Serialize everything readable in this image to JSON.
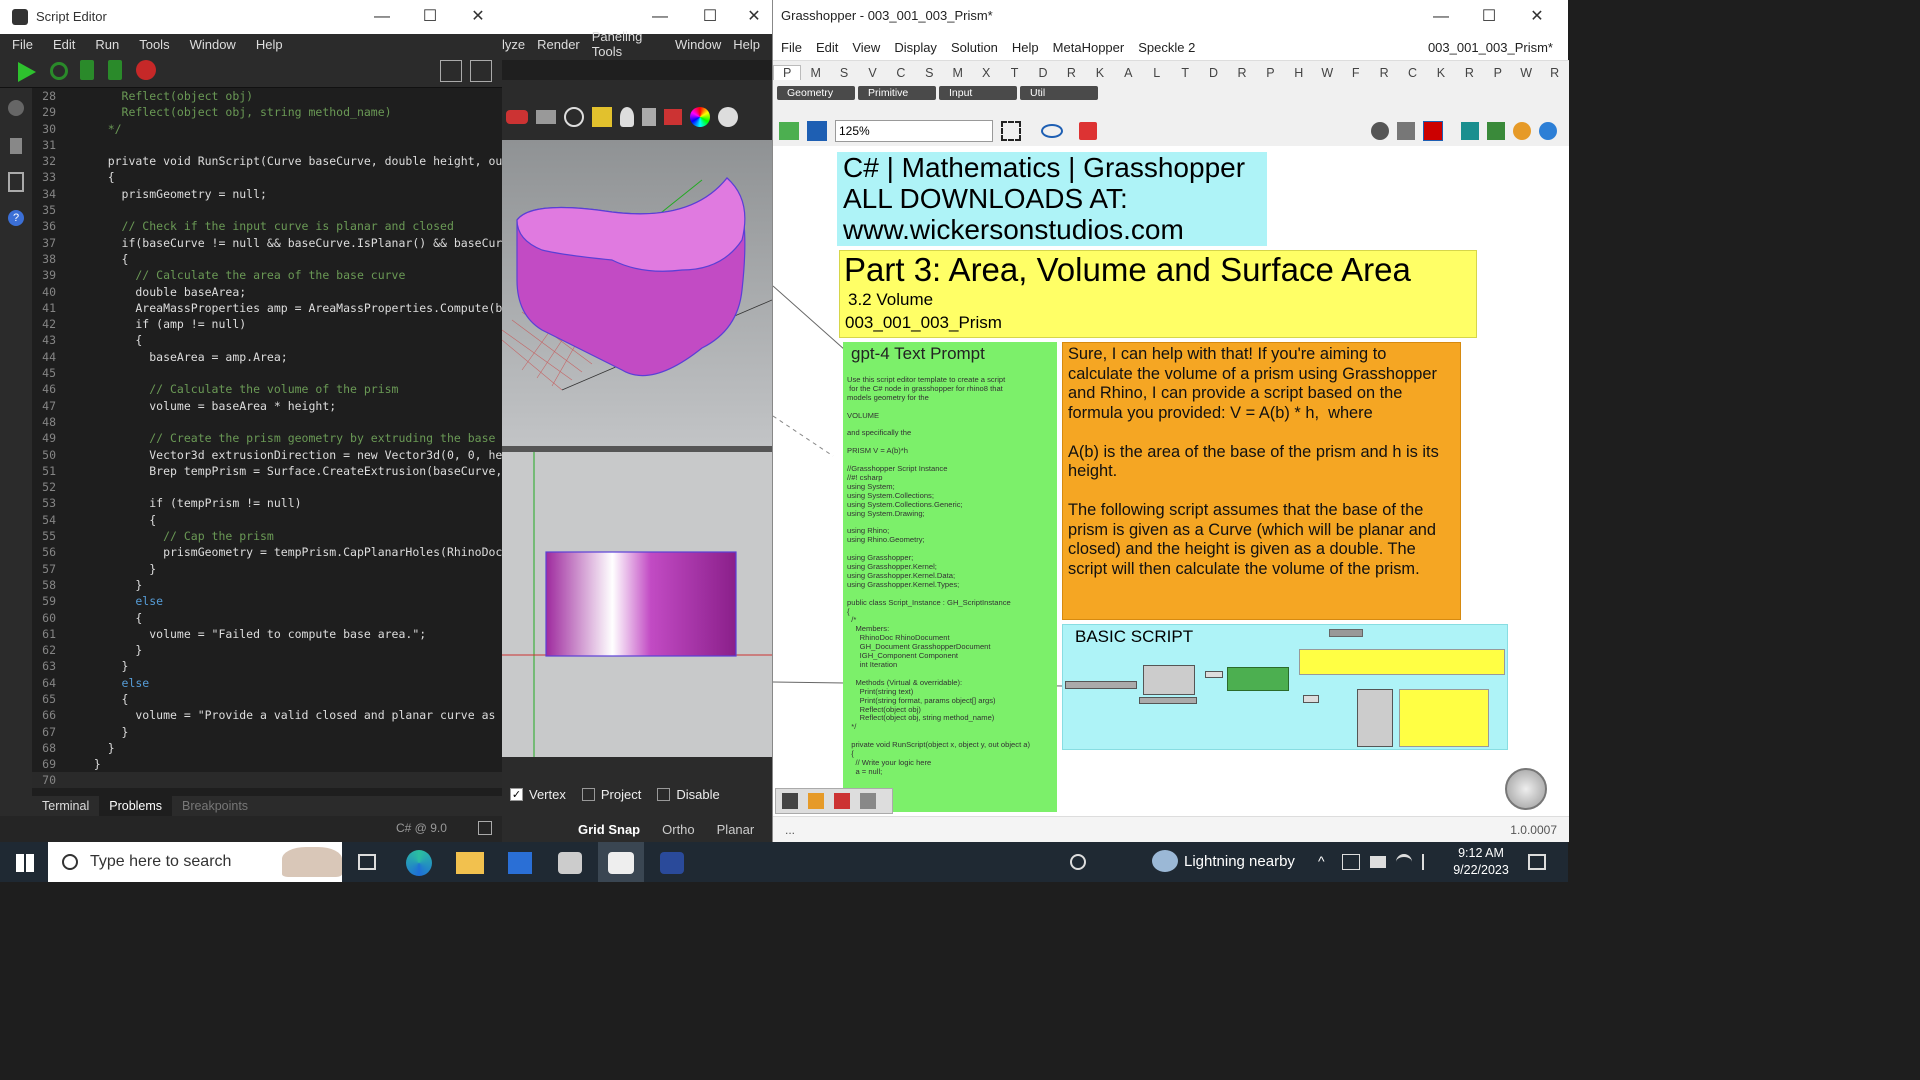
{
  "script_editor": {
    "title": "Script Editor",
    "menu": [
      "File",
      "Edit",
      "Run",
      "Tools",
      "Window",
      "Help"
    ],
    "code_lines": [
      {
        "n": "28",
        "t": "      Reflect(object obj)",
        "c": "cm"
      },
      {
        "n": "29",
        "t": "      Reflect(object obj, string method_name)",
        "c": "cm"
      },
      {
        "n": "30",
        "t": "    */",
        "c": "cm"
      },
      {
        "n": "31",
        "t": "",
        "c": ""
      },
      {
        "n": "32",
        "t": "    private void RunScript(Curve baseCurve, double height, ou",
        "c": ""
      },
      {
        "n": "33",
        "t": "    {",
        "c": ""
      },
      {
        "n": "34",
        "t": "      prismGeometry = null;",
        "c": ""
      },
      {
        "n": "35",
        "t": "",
        "c": ""
      },
      {
        "n": "36",
        "t": "      // Check if the input curve is planar and closed",
        "c": "cm"
      },
      {
        "n": "37",
        "t": "      if(baseCurve != null && baseCurve.IsPlanar() && baseCur",
        "c": ""
      },
      {
        "n": "38",
        "t": "      {",
        "c": ""
      },
      {
        "n": "39",
        "t": "        // Calculate the area of the base curve",
        "c": "cm"
      },
      {
        "n": "40",
        "t": "        double baseArea;",
        "c": ""
      },
      {
        "n": "41",
        "t": "        AreaMassProperties amp = AreaMassProperties.Compute(b",
        "c": ""
      },
      {
        "n": "42",
        "t": "        if (amp != null)",
        "c": ""
      },
      {
        "n": "43",
        "t": "        {",
        "c": ""
      },
      {
        "n": "44",
        "t": "          baseArea = amp.Area;",
        "c": ""
      },
      {
        "n": "45",
        "t": "",
        "c": ""
      },
      {
        "n": "46",
        "t": "          // Calculate the volume of the prism",
        "c": "cm"
      },
      {
        "n": "47",
        "t": "          volume = baseArea * height;",
        "c": ""
      },
      {
        "n": "48",
        "t": "",
        "c": ""
      },
      {
        "n": "49",
        "t": "          // Create the prism geometry by extruding the base",
        "c": "cm"
      },
      {
        "n": "50",
        "t": "          Vector3d extrusionDirection = new Vector3d(0, 0, he",
        "c": ""
      },
      {
        "n": "51",
        "t": "          Brep tempPrism = Surface.CreateExtrusion(baseCurve,",
        "c": ""
      },
      {
        "n": "52",
        "t": "",
        "c": ""
      },
      {
        "n": "53",
        "t": "          if (tempPrism != null)",
        "c": ""
      },
      {
        "n": "54",
        "t": "          {",
        "c": ""
      },
      {
        "n": "55",
        "t": "            // Cap the prism",
        "c": "cm"
      },
      {
        "n": "56",
        "t": "            prismGeometry = tempPrism.CapPlanarHoles(RhinoDoc",
        "c": ""
      },
      {
        "n": "57",
        "t": "          }",
        "c": ""
      },
      {
        "n": "58",
        "t": "        }",
        "c": ""
      },
      {
        "n": "59",
        "t": "        else",
        "c": "kw"
      },
      {
        "n": "60",
        "t": "        {",
        "c": ""
      },
      {
        "n": "61",
        "t": "          volume = \"Failed to compute base area.\";",
        "c": ""
      },
      {
        "n": "62",
        "t": "        }",
        "c": ""
      },
      {
        "n": "63",
        "t": "      }",
        "c": ""
      },
      {
        "n": "64",
        "t": "      else",
        "c": "kw"
      },
      {
        "n": "65",
        "t": "      {",
        "c": ""
      },
      {
        "n": "66",
        "t": "        volume = \"Provide a valid closed and planar curve as",
        "c": ""
      },
      {
        "n": "67",
        "t": "      }",
        "c": ""
      },
      {
        "n": "68",
        "t": "    }",
        "c": ""
      },
      {
        "n": "69",
        "t": "  }",
        "c": ""
      },
      {
        "n": "70",
        "t": "",
        "c": ""
      }
    ],
    "bottom_tabs": [
      "Terminal",
      "Problems",
      "Breakpoints"
    ],
    "status": "C# @ 9.0"
  },
  "rhino": {
    "menu": [
      "lyze",
      "Render",
      "Paneling Tools",
      "Window",
      "Help"
    ],
    "snaps": [
      "Vertex",
      "Project",
      "Disable"
    ],
    "status": [
      "Grid Snap",
      "Ortho",
      "Planar"
    ]
  },
  "grasshopper": {
    "title": "Grasshopper - 003_001_003_Prism*",
    "menu": [
      "File",
      "Edit",
      "View",
      "Display",
      "Solution",
      "Help",
      "MetaHopper",
      "Speckle 2"
    ],
    "doc_name": "003_001_003_Prism*",
    "tabs": [
      "P",
      "M",
      "S",
      "V",
      "C",
      "S",
      "M",
      "X",
      "T",
      "D",
      "R",
      "K",
      "A",
      "L",
      "T",
      "D",
      "R",
      "P",
      "H",
      "W",
      "F",
      "R",
      "C",
      "K",
      "R",
      "P",
      "W",
      "R"
    ],
    "categories": [
      "Geometry",
      "Primitive",
      "Input",
      "Util"
    ],
    "zoom": "125%",
    "header": [
      "C# | Mathematics | Grasshopper",
      "ALL DOWNLOADS AT:",
      "www.wickersonstudios.com"
    ],
    "part_title": "Part 3: Area, Volume and Surface Area",
    "section": "3.2 Volume",
    "file_label": "003_001_003_Prism",
    "prompt_title": "gpt-4 Text Prompt",
    "prompt_text": "Use this script editor template to create a script\n for the C# node in grasshopper for rhino8 that\nmodels geometry for the\n\nVOLUME\n\nand specifically the\n\nPRISM V = A(b)*h\n\n//Grasshopper Script Instance\n//#! csharp\nusing System;\nusing System.Collections;\nusing System.Collections.Generic;\nusing System.Drawing;\n\nusing Rhino;\nusing Rhino.Geometry;\n\nusing Grasshopper;\nusing Grasshopper.Kernel;\nusing Grasshopper.Kernel.Data;\nusing Grasshopper.Kernel.Types;\n\npublic class Script_Instance : GH_ScriptInstance\n{\n  /*\n    Members:\n      RhinoDoc RhinoDocument\n      GH_Document GrasshopperDocument\n      IGH_Component Component\n      int Iteration\n\n    Methods (Virtual & overridable):\n      Print(string text)\n      Print(string format, params object[] args)\n      Reflect(object obj)\n      Reflect(object obj, string method_name)\n  */\n\n  private void RunScript(object x, object y, out object a)\n  {\n    // Write your logic here\n    a = null;",
    "answer_text": "Sure, I can help with that! If you're aiming to calculate the volume of a prism using Grasshopper and Rhino, I can provide a script based on the formula you provided: V = A(b) * h,  where\n\nA(b) is the area of the base of the prism and h is its height.\n\nThe following script assumes that the base of the prism is given as a Curve (which will be planar and closed) and the height is given as a double. The script will then calculate the volume of the prism.",
    "basic_script": "BASIC SCRIPT",
    "status_left": "...",
    "version": "1.0.0007"
  },
  "taskbar": {
    "search_placeholder": "Type here to search",
    "weather": "Lightning nearby",
    "time": "9:12 AM",
    "date": "9/22/2023"
  },
  "colors": {
    "cyan": "#aef3f7",
    "yellow": "#ffff66",
    "green": "#7cf06a",
    "orange": "#f5a623"
  }
}
